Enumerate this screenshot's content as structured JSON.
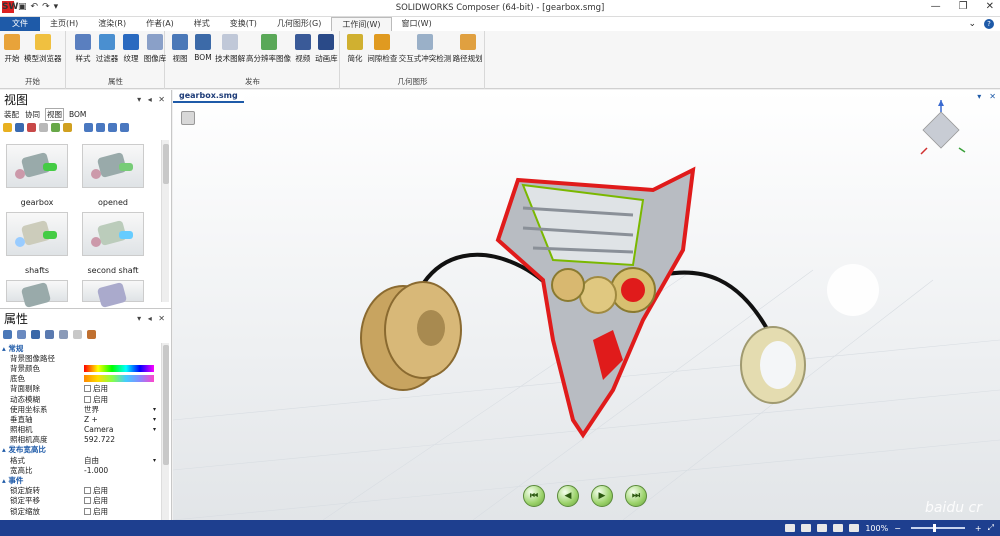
{
  "titlebar": {
    "title": "SOLIDWORKS Composer (64-bit) - [gearbox.smg]",
    "app_icon": "SW"
  },
  "menu": {
    "file": "文件",
    "items": [
      "主页(H)",
      "渲染(R)",
      "作者(A)",
      "样式",
      "变换(T)",
      "几何图形(G)",
      "工作间(W)",
      "窗口(W)"
    ],
    "active_index": 6
  },
  "ribbon": {
    "groups": [
      {
        "label": "开始",
        "buttons": [
          "开始",
          "模型浏览器"
        ]
      },
      {
        "label": "属性",
        "buttons": [
          "样式",
          "过滤器",
          "纹理",
          "图像库"
        ]
      },
      {
        "label": "发布",
        "buttons": [
          "视图",
          "BOM",
          "技术图解",
          "高分辨率图像",
          "视频",
          "动画库"
        ]
      },
      {
        "label": "几何图形",
        "buttons": [
          "简化",
          "间隙检查",
          "交互式冲突检测",
          "路径规划"
        ]
      }
    ]
  },
  "views_panel": {
    "title": "视图",
    "tabs": [
      "装配",
      "协同",
      "视图",
      "BOM"
    ],
    "active_tab": 2,
    "thumbnails": [
      "gearbox",
      "opened",
      "shafts",
      "second shaft"
    ]
  },
  "props_panel": {
    "title": "属性",
    "rows": [
      {
        "type": "cat",
        "key": "常规"
      },
      {
        "key": "背景图像路径",
        "value": ""
      },
      {
        "key": "背景颜色",
        "value": "",
        "widget": "rainbow"
      },
      {
        "key": "底色",
        "value": "",
        "widget": "rainbow2"
      },
      {
        "key": "背面剔除",
        "value": "启用",
        "widget": "check"
      },
      {
        "key": "动态模糊",
        "value": "启用",
        "widget": "check"
      },
      {
        "key": "使用坐标系",
        "value": "世界",
        "widget": "dropdown"
      },
      {
        "key": "垂直轴",
        "value": "Z +",
        "widget": "dropdown"
      },
      {
        "key": "照相机",
        "value": "Camera",
        "widget": "dropdown"
      },
      {
        "key": "照相机高度",
        "value": "592.722"
      },
      {
        "type": "cat",
        "key": "发布宽高比"
      },
      {
        "key": "格式",
        "value": "自由",
        "widget": "dropdown"
      },
      {
        "key": "宽高比",
        "value": "-1.000"
      },
      {
        "type": "cat",
        "key": "事件"
      },
      {
        "key": "锁定旋转",
        "value": "启用",
        "widget": "check"
      },
      {
        "key": "锁定平移",
        "value": "启用",
        "widget": "check"
      },
      {
        "key": "锁定缩放",
        "value": "启用",
        "widget": "check"
      }
    ]
  },
  "viewport": {
    "tab": "gearbox.smg",
    "watermark": "baidu cr"
  },
  "status": {
    "zoom": "100%"
  },
  "colors": {
    "accent": "#1e5aa8",
    "status_bar": "#1e3f8f",
    "cut_section": "#e01b1b"
  }
}
